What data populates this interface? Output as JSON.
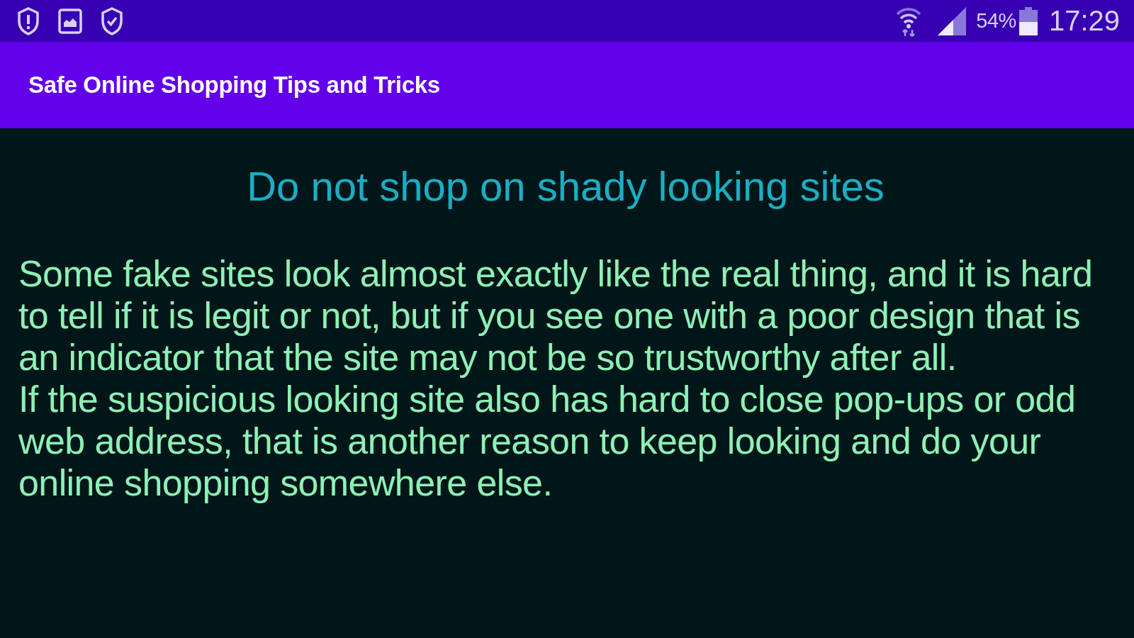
{
  "status_bar": {
    "battery_percent": "54%",
    "time": "17:29"
  },
  "app_bar": {
    "title": "Safe Online Shopping Tips and Tricks"
  },
  "content": {
    "heading": "Do not shop on shady looking sites",
    "paragraphs": [
      "Some fake sites look almost exactly like the real thing, and it is hard to tell if it is legit or not, but if you see one with a poor design that is an indicator that the site may not be so trustworthy after all.",
      "If the suspicious looking site also has hard to close pop-ups or odd web address, that is another reason to keep looking and do your online shopping somewhere else."
    ]
  }
}
